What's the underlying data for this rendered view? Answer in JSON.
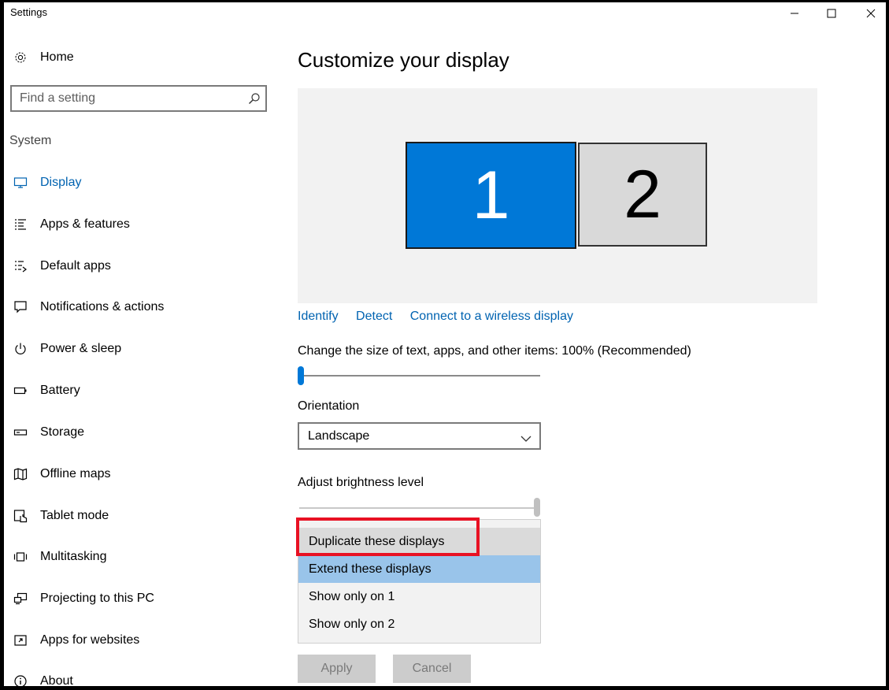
{
  "window": {
    "title": "Settings",
    "controls": [
      "minimize-icon",
      "maximize-icon",
      "close-icon"
    ]
  },
  "sidebar": {
    "home_label": "Home",
    "search_placeholder": "Find a setting",
    "section_label": "System",
    "items": [
      {
        "label": "Display",
        "icon": "display-icon",
        "active": true
      },
      {
        "label": "Apps & features",
        "icon": "list-icon"
      },
      {
        "label": "Default apps",
        "icon": "default-apps-icon"
      },
      {
        "label": "Notifications & actions",
        "icon": "notification-icon"
      },
      {
        "label": "Power & sleep",
        "icon": "power-icon"
      },
      {
        "label": "Battery",
        "icon": "battery-icon"
      },
      {
        "label": "Storage",
        "icon": "storage-icon"
      },
      {
        "label": "Offline maps",
        "icon": "map-icon"
      },
      {
        "label": "Tablet mode",
        "icon": "tablet-icon"
      },
      {
        "label": "Multitasking",
        "icon": "multitasking-icon"
      },
      {
        "label": "Projecting to this PC",
        "icon": "projecting-icon"
      },
      {
        "label": "Apps for websites",
        "icon": "apps-websites-icon"
      },
      {
        "label": "About",
        "icon": "info-icon"
      }
    ]
  },
  "main": {
    "title": "Customize your display",
    "monitors": [
      {
        "label": "1",
        "selected": true
      },
      {
        "label": "2",
        "selected": false
      }
    ],
    "links": {
      "identify": "Identify",
      "detect": "Detect",
      "connect": "Connect to a wireless display"
    },
    "scale": {
      "label": "Change the size of text, apps, and other items: 100% (Recommended)",
      "value_fraction": 0.0
    },
    "orientation": {
      "label": "Orientation",
      "value": "Landscape"
    },
    "brightness": {
      "label": "Adjust brightness level",
      "value_fraction": 1.0
    },
    "multiple_displays": {
      "options": [
        "Duplicate these displays",
        "Extend these displays",
        "Show only on 1",
        "Show only on 2"
      ],
      "hovered_index": 0,
      "selected_index": 1,
      "highlighted_option": "Duplicate these displays"
    },
    "buttons": {
      "apply": "Apply",
      "cancel": "Cancel"
    }
  },
  "colors": {
    "accent": "#0078d7",
    "link": "#0063b1",
    "highlight": "#e81123",
    "selected_item": "#99c4ea"
  }
}
